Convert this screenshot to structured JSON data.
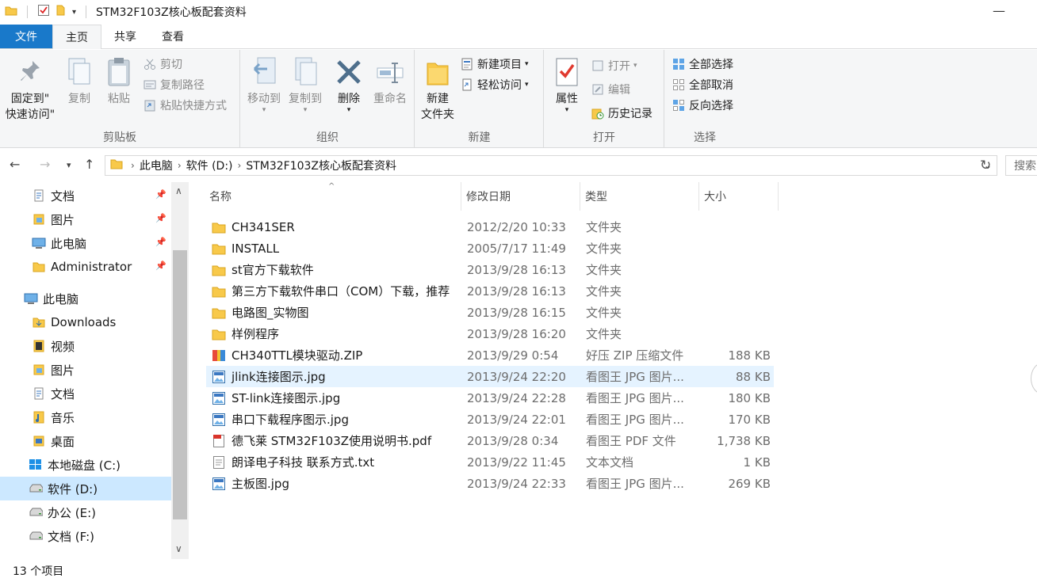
{
  "window": {
    "title": "STM32F103Z核心板配套资料",
    "minimize_glyph": "—"
  },
  "tabs": [
    {
      "label": "文件"
    },
    {
      "label": "主页"
    },
    {
      "label": "共享"
    },
    {
      "label": "查看"
    }
  ],
  "ribbon": {
    "clipboard": {
      "label": "剪贴板",
      "pin_quick_access": "固定到\"\n快速访问\"",
      "copy": "复制",
      "paste": "粘贴",
      "cut": "剪切",
      "copy_path": "复制路径",
      "paste_shortcut": "粘贴快捷方式"
    },
    "organize": {
      "label": "组织",
      "move_to": "移动到",
      "copy_to": "复制到",
      "delete": "删除",
      "rename": "重命名"
    },
    "new": {
      "label": "新建",
      "new_folder": "新建\n文件夹",
      "new_item": "新建项目",
      "easy_access": "轻松访问"
    },
    "open": {
      "label": "打开",
      "properties": "属性",
      "open": "打开",
      "edit": "编辑",
      "history": "历史记录"
    },
    "select": {
      "label": "选择",
      "select_all": "全部选择",
      "select_none": "全部取消",
      "invert": "反向选择"
    }
  },
  "address": {
    "crumbs": [
      "此电脑",
      "软件 (D:)",
      "STM32F103Z核心板配套资料"
    ],
    "search_placeholder": "搜索"
  },
  "nav": {
    "quick_access": [
      {
        "label": "文档",
        "icon": "document-folder-icon",
        "pinned": true
      },
      {
        "label": "图片",
        "icon": "pictures-folder-icon",
        "pinned": true
      },
      {
        "label": "此电脑",
        "icon": "computer-icon",
        "pinned": true
      },
      {
        "label": "Administrator",
        "icon": "folder-icon",
        "pinned": true
      }
    ],
    "this_pc_label": "此电脑",
    "this_pc_items": [
      {
        "label": "Downloads",
        "icon": "downloads-folder-icon"
      },
      {
        "label": "视频",
        "icon": "videos-folder-icon"
      },
      {
        "label": "图片",
        "icon": "pictures-folder-icon"
      },
      {
        "label": "文档",
        "icon": "document-folder-icon"
      },
      {
        "label": "音乐",
        "icon": "music-folder-icon"
      },
      {
        "label": "桌面",
        "icon": "desktop-folder-icon"
      },
      {
        "label": "本地磁盘 (C:)",
        "icon": "windows-drive-icon"
      },
      {
        "label": "软件 (D:)",
        "icon": "drive-icon",
        "selected": true
      },
      {
        "label": "办公 (E:)",
        "icon": "drive-icon"
      },
      {
        "label": "文档 (F:)",
        "icon": "drive-icon"
      }
    ]
  },
  "columns": {
    "name": "名称",
    "date": "修改日期",
    "type": "类型",
    "size": "大小"
  },
  "files": [
    {
      "name": "CH341SER",
      "date": "2012/2/20 10:33",
      "type": "文件夹",
      "size": "",
      "icon": "folder"
    },
    {
      "name": "INSTALL",
      "date": "2005/7/17 11:49",
      "type": "文件夹",
      "size": "",
      "icon": "folder"
    },
    {
      "name": "st官方下载软件",
      "date": "2013/9/28 16:13",
      "type": "文件夹",
      "size": "",
      "icon": "folder"
    },
    {
      "name": "第三方下载软件串口（COM）下载，推荐",
      "date": "2013/9/28 16:13",
      "type": "文件夹",
      "size": "",
      "icon": "folder"
    },
    {
      "name": "电路图_实物图",
      "date": "2013/9/28 16:15",
      "type": "文件夹",
      "size": "",
      "icon": "folder"
    },
    {
      "name": "样例程序",
      "date": "2013/9/28 16:20",
      "type": "文件夹",
      "size": "",
      "icon": "folder"
    },
    {
      "name": "CH340TTL模块驱动.ZIP",
      "date": "2013/9/29 0:54",
      "type": "好压 ZIP 压缩文件",
      "size": "188 KB",
      "icon": "zip"
    },
    {
      "name": "jlink连接图示.jpg",
      "date": "2013/9/24 22:20",
      "type": "看图王 JPG 图片...",
      "size": "88 KB",
      "icon": "image",
      "selected": true
    },
    {
      "name": "ST-link连接图示.jpg",
      "date": "2013/9/24 22:28",
      "type": "看图王 JPG 图片...",
      "size": "180 KB",
      "icon": "image"
    },
    {
      "name": "串口下载程序图示.jpg",
      "date": "2013/9/24 22:01",
      "type": "看图王 JPG 图片...",
      "size": "170 KB",
      "icon": "image"
    },
    {
      "name": "德飞莱 STM32F103Z使用说明书.pdf",
      "date": "2013/9/28 0:34",
      "type": "看图王 PDF 文件",
      "size": "1,738 KB",
      "icon": "pdf"
    },
    {
      "name": "朗译电子科技 联系方式.txt",
      "date": "2013/9/22 11:45",
      "type": "文本文档",
      "size": "1 KB",
      "icon": "text"
    },
    {
      "name": "主板图.jpg",
      "date": "2013/9/24 22:33",
      "type": "看图王 JPG 图片...",
      "size": "269 KB",
      "icon": "image"
    }
  ],
  "status": {
    "item_count": "13 个项目"
  },
  "colors": {
    "accent": "#1979ca",
    "selection": "#cce8ff",
    "hover_row": "#e5f3ff",
    "folder": "#f8c94a"
  }
}
